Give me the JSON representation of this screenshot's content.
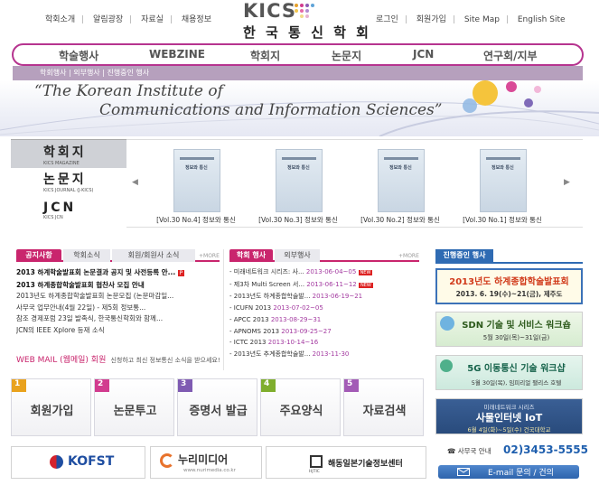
{
  "header": {
    "left_links": [
      "학회소개",
      "알림광장",
      "자료실",
      "채용정보"
    ],
    "logo_text": "KICS",
    "logo_name": "한 국 통 신 학 회",
    "right_links": [
      "로그인",
      "회원가입",
      "Site Map",
      "English Site"
    ]
  },
  "nav": {
    "items": [
      "학술행사",
      "WEBZINE",
      "학회지",
      "논문지",
      "JCN",
      "연구회/지부"
    ],
    "breadcrumb": "학회행사 | 외부행사 | 진행중인 행사",
    "accent": "#b6348f"
  },
  "banner": {
    "line1": "“The Korean Institute of",
    "line2": "Communications and Information Sciences”"
  },
  "magazines": {
    "tabs": [
      {
        "title": "학회지",
        "sub": "KICS MAGAZINE"
      },
      {
        "title": "논문지",
        "sub": "KICS JOURNAL (J-KICS)"
      },
      {
        "title": "JCN",
        "sub": "KICS JCN"
      }
    ],
    "cover_title": "정보와 통신",
    "items": [
      "[Vol.30 No.4] 정보와 통신",
      "[Vol.30 No.3] 정보와 통신",
      "[Vol.30 No.2] 정보와 통신",
      "[Vol.30 No.1] 정보와 통신"
    ]
  },
  "notices": {
    "tabs": [
      "공지사항",
      "학회소식",
      "회원/회원사 소식"
    ],
    "more": "+MORE",
    "items": [
      "2013 하계학술발표회 논문결과 공지 및 사전등록 안...",
      "2013 하계종합학술발표회 협찬사 모집 안내",
      "2013년도 하계종합학술발표회 논문모집 (논문마감일...",
      "사무국 업무안내(4월 22일) - 제5회 정보통...",
      "참조 경제포럼 23일 발족식, 한국통신학회와 함께...",
      "JCN의 IEEE Xplore 등재 소식"
    ],
    "webmail": "WEB MAIL (웹메일) 회원",
    "webmail_desc": "신청하고 최신 정보통신 소식을 받으세요!"
  },
  "events": {
    "tabs": [
      "학회 행사",
      "외부행사"
    ],
    "more": "+MORE",
    "items": [
      {
        "title": "- 미래네트워크 시리즈: 사...",
        "date": "2013-06-04~05",
        "new": true
      },
      {
        "title": "- 제3차 Multi Screen 서...",
        "date": "2013-06-11~12",
        "new": true
      },
      {
        "title": "- 2013년도 하계종합학술발...",
        "date": "2013-06-19~21",
        "new": false
      },
      {
        "title": "- ICUFN 2013",
        "date": "2013-07-02~05",
        "new": false
      },
      {
        "title": "- APCC 2013",
        "date": "2013-08-29~31",
        "new": false
      },
      {
        "title": "- APNOMS 2013",
        "date": "2013-09-25~27",
        "new": false
      },
      {
        "title": "- ICTC 2013",
        "date": "2013-10-14~16",
        "new": false
      },
      {
        "title": "- 2013년도 추계종합학술발...",
        "date": "2013-11-30",
        "new": false
      }
    ],
    "new_badge": "NEW"
  },
  "ongoing": {
    "tab": "진행중인 행사",
    "boxes": [
      {
        "title": "2013년도 하계종합학술발표회",
        "sub": "2013. 6. 19(수)~21(금), 제주도"
      },
      {
        "title": "SDN 기술 및 서비스 워크숍",
        "sub": "5월 30일(목)~31일(금)"
      },
      {
        "title": "5G 이동통신 기술 워크샵",
        "sub": "5월 30일(목), 임피리얼 팰리스 호텔"
      },
      {
        "title": "미래네트워크 시리즈",
        "title2": "사물인터넷 IoT",
        "sub": "6월 4일(화)~5일(수) 건국대학교"
      }
    ]
  },
  "quick_menu": [
    {
      "num": "1",
      "label": "회원가입",
      "color": "#e9a21d"
    },
    {
      "num": "2",
      "label": "논문투고",
      "color": "#d23c8f"
    },
    {
      "num": "3",
      "label": "증명서 발급",
      "color": "#7f5bb2"
    },
    {
      "num": "4",
      "label": "주요양식",
      "color": "#7fae2d"
    },
    {
      "num": "5",
      "label": "자료검색",
      "color": "#a35bb6"
    }
  ],
  "partners": {
    "kofst": "KOFST",
    "nurimedia": "누리미디어",
    "nurimedia_url": "www.nurimedia.co.kr",
    "haedong": "해동일본기술정보센터",
    "haedong_small": "HJTIC"
  },
  "contact": {
    "label": "☎ 사무국 안내",
    "phone": "02)3453-5555",
    "email": "E-mail 문의 / 건의"
  }
}
